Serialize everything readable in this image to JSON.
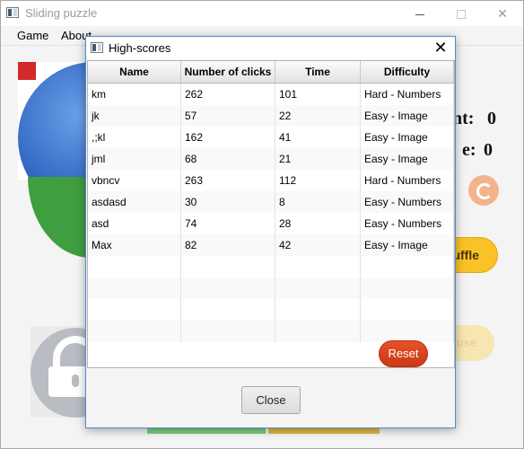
{
  "window": {
    "title": "Sliding puzzle",
    "close_glyph": "✕"
  },
  "menu": {
    "items": [
      "Game",
      "About"
    ]
  },
  "background": {
    "count_label": "nt:",
    "count_value": "0",
    "time_label": "e:",
    "time_value": "0",
    "shuffle_label": "uffle",
    "pause_label": "use",
    "icons": [
      "reload-icon",
      "lock-icon"
    ]
  },
  "dialog": {
    "title": "High-scores",
    "close_glyph": "✕",
    "columns": [
      "Name",
      "Number of clicks",
      "Time",
      "Difficulty"
    ],
    "rows": [
      [
        "km",
        "262",
        "101",
        "Hard - Numbers"
      ],
      [
        "jk",
        "57",
        "22",
        "Easy - Image"
      ],
      [
        ",;kl",
        "162",
        "41",
        "Easy - Image"
      ],
      [
        "jml",
        "68",
        "21",
        "Easy - Image"
      ],
      [
        "vbncv",
        "263",
        "112",
        "Hard - Numbers"
      ],
      [
        "asdasd",
        "30",
        "8",
        "Easy - Numbers"
      ],
      [
        "asd",
        "74",
        "28",
        "Easy - Numbers"
      ],
      [
        "Max",
        "82",
        "42",
        "Easy - Image"
      ],
      [
        "",
        "",
        "",
        ""
      ],
      [
        "",
        "",
        "",
        ""
      ],
      [
        "",
        "",
        "",
        ""
      ],
      [
        "",
        "",
        "",
        ""
      ]
    ],
    "reset_label": "Reset",
    "close_label": "Close"
  },
  "colors": {
    "accent_reset": "#d9431e",
    "dialog_border": "#4a8fcf",
    "shuffle": "#f9c327"
  }
}
